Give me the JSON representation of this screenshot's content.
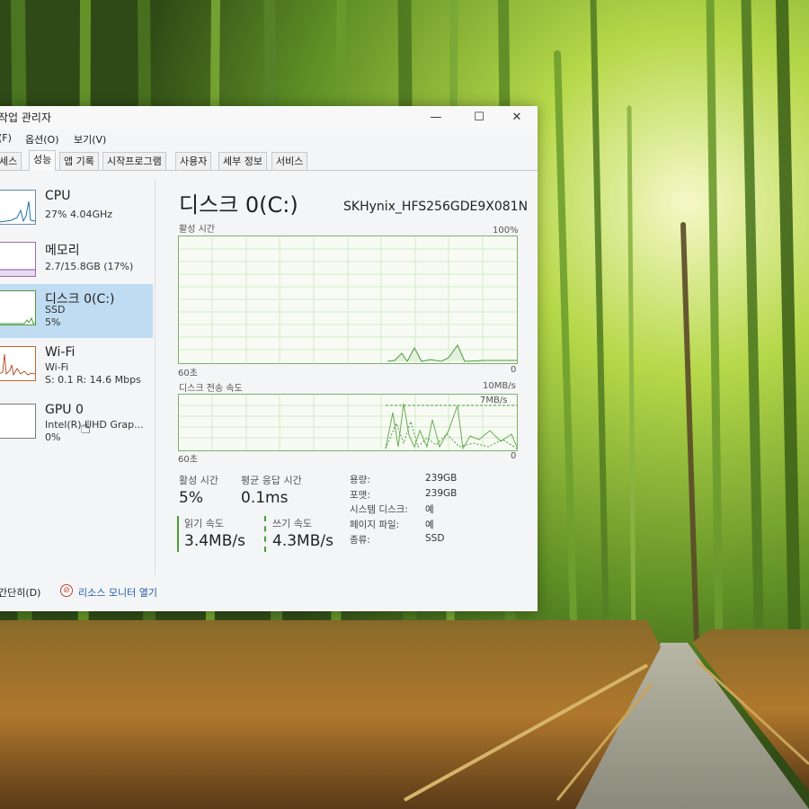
{
  "window": {
    "title": "작업 관리자",
    "controls": {
      "minimize": "—",
      "maximize": "☐",
      "close": "✕"
    },
    "menu": [
      "(F)",
      "옵션(O)",
      "보기(V)"
    ],
    "tabs": [
      "세스",
      "성능",
      "앱 기록",
      "시작프로그램",
      "사용자",
      "세부 정보",
      "서비스"
    ],
    "active_tab": "성능"
  },
  "resources": [
    {
      "name": "CPU",
      "line1": "27%  4.04GHz",
      "line2": ""
    },
    {
      "name": "메모리",
      "line1": "2.7/15.8GB (17%)",
      "line2": ""
    },
    {
      "name": "디스크 0(C:)",
      "line1": "SSD",
      "line2": "5%"
    },
    {
      "name": "Wi-Fi",
      "line1": "Wi-Fi",
      "line2": "S: 0.1  R: 14.6 Mbps"
    },
    {
      "name": "GPU 0",
      "line1": "Intel(R) UHD Grap...",
      "line2": "0%"
    }
  ],
  "disk": {
    "title": "디스크 0(C:)",
    "model": "SKHynix_HFS256GDE9X081N",
    "graph1": {
      "label": "활성 시간",
      "max": "100%",
      "left": "60초",
      "right": "0"
    },
    "graph2": {
      "label": "디스크 전송 속도",
      "max": "10MB/s",
      "inner": "7MB/s",
      "left": "60초",
      "right": "0"
    },
    "stats": {
      "active_label": "활성 시간",
      "active_value": "5%",
      "response_label": "평균 응답 시간",
      "response_value": "0.1ms",
      "read_label": "읽기 속도",
      "read_value": "3.4MB/s",
      "write_label": "쓰기 속도",
      "write_value": "4.3MB/s"
    },
    "info": [
      {
        "label": "용량:",
        "value": "239GB"
      },
      {
        "label": "포맷:",
        "value": "239GB"
      },
      {
        "label": "시스템 디스크:",
        "value": "예"
      },
      {
        "label": "페이지 파일:",
        "value": "예"
      },
      {
        "label": "종류:",
        "value": "SSD"
      }
    ]
  },
  "footer": {
    "fewer": "간단히(D)",
    "monitor": "리소스 모니터 열기"
  },
  "colors": {
    "accent": "#4c9a3c",
    "selection": "#c0dcf2",
    "link": "#1e5aa8"
  }
}
